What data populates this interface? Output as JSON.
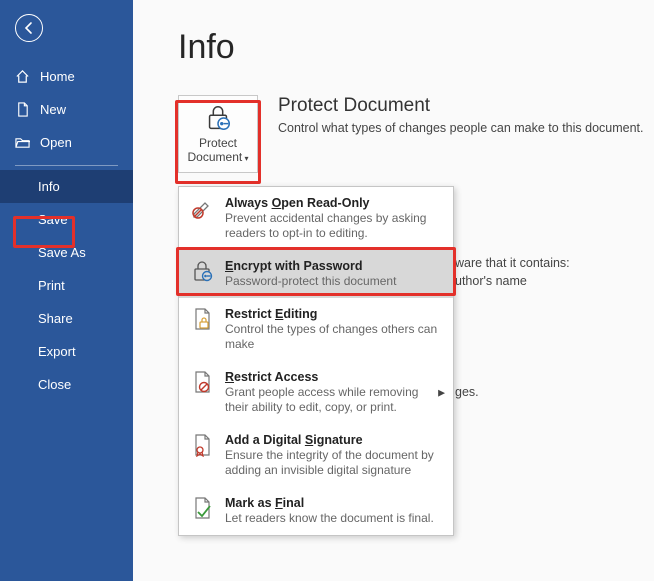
{
  "sidebar": {
    "items": [
      {
        "label": "Home"
      },
      {
        "label": "New"
      },
      {
        "label": "Open"
      },
      {
        "label": "Info"
      },
      {
        "label": "Save"
      },
      {
        "label": "Save As"
      },
      {
        "label": "Print"
      },
      {
        "label": "Share"
      },
      {
        "label": "Export"
      },
      {
        "label": "Close"
      }
    ]
  },
  "page": {
    "title": "Info"
  },
  "protect": {
    "button_line1": "Protect",
    "button_line2": "Document",
    "heading": "Protect Document",
    "description": "Control what types of changes people can make to this document."
  },
  "dropdown": {
    "items": [
      {
        "title_pre": "Always ",
        "title_u": "O",
        "title_post": "pen Read-Only",
        "desc": "Prevent accidental changes by asking readers to opt-in to editing."
      },
      {
        "title_pre": "",
        "title_u": "E",
        "title_post": "ncrypt with Password",
        "desc": "Password-protect this document"
      },
      {
        "title_pre": "Restrict ",
        "title_u": "E",
        "title_post": "diting",
        "desc": "Control the types of changes others can make"
      },
      {
        "title_pre": "",
        "title_u": "R",
        "title_post": "estrict Access",
        "desc": "Grant people access while removing their ability to edit, copy, or print."
      },
      {
        "title_pre": "Add a Digital ",
        "title_u": "S",
        "title_post": "ignature",
        "desc": "Ensure the integrity of the document by adding an invisible digital signature"
      },
      {
        "title_pre": "Mark as ",
        "title_u": "F",
        "title_post": "inal",
        "desc": "Let readers know the document is final."
      }
    ]
  },
  "behind": {
    "line1": "ware that it contains:",
    "line2": "uthor's name",
    "line3": "ges."
  }
}
